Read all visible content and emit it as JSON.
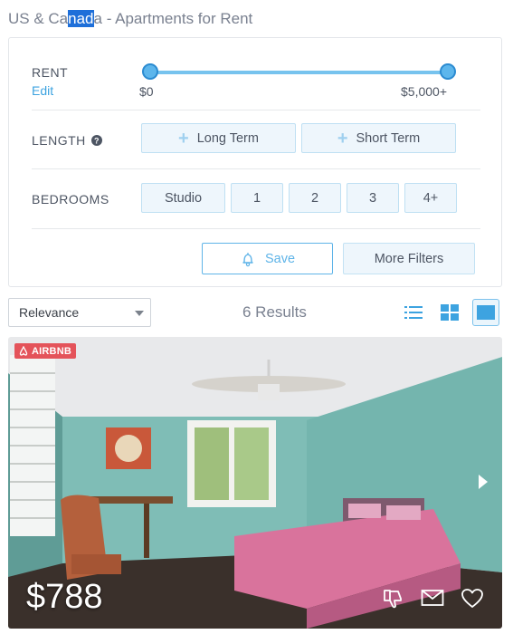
{
  "page_title": {
    "before": "US & Ca",
    "selected": "nad",
    "after": "a - Apartments for Rent"
  },
  "filters": {
    "rent": {
      "label": "RENT",
      "edit": "Edit",
      "min_label": "$0",
      "max_label": "$5,000+",
      "min_fraction": 0,
      "max_fraction": 1
    },
    "length": {
      "label": "LENGTH",
      "options": [
        "Long Term",
        "Short Term"
      ]
    },
    "bedrooms": {
      "label": "BEDROOMS",
      "options": [
        "Studio",
        "1",
        "2",
        "3",
        "4+"
      ]
    },
    "save_label": "Save",
    "more_filters_label": "More Filters"
  },
  "sort": {
    "selected": "Relevance"
  },
  "results": {
    "count_label": "6 Results"
  },
  "view_modes": [
    "list-view-icon",
    "grid-view-icon",
    "map-view-icon"
  ],
  "listing": {
    "badge": "AIRBNB",
    "price": "$788"
  },
  "colors": {
    "accent": "#3da3e0",
    "badge": "#e4535a",
    "wall": "#7fbfb7"
  }
}
